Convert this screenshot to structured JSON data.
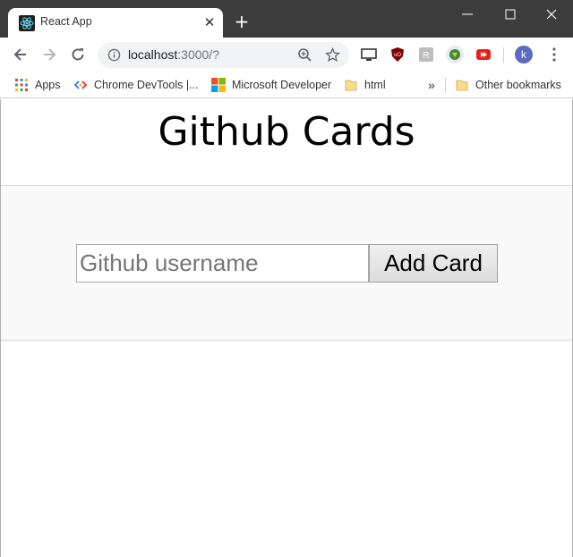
{
  "browser": {
    "tab": {
      "title": "React App",
      "favicon": "react-icon"
    },
    "omnibox": {
      "host": "localhost",
      "path": ":3000/?"
    },
    "profile_initial": "k",
    "colors": {
      "titlebar": "#3c3c3c",
      "omnibox_bg": "#f1f3f4",
      "avatar": "#5c6bc0"
    },
    "extensions": [
      "cast-icon",
      "ublock-icon",
      "extension-icon",
      "idm-icon",
      "youtube-icon"
    ]
  },
  "bookmarks": {
    "items": [
      {
        "label": "Apps",
        "icon": "apps-grid-icon"
      },
      {
        "label": "Chrome DevTools  |...",
        "icon": "devtools-icon"
      },
      {
        "label": "Microsoft Developer",
        "icon": "microsoft-icon"
      },
      {
        "label": "html",
        "icon": "folder-icon"
      }
    ],
    "overflow": "»",
    "other": {
      "label": "Other bookmarks",
      "icon": "folder-icon"
    }
  },
  "page": {
    "title": "Github Cards",
    "form": {
      "input_placeholder": "Github username",
      "input_value": "",
      "button_label": "Add Card"
    }
  }
}
